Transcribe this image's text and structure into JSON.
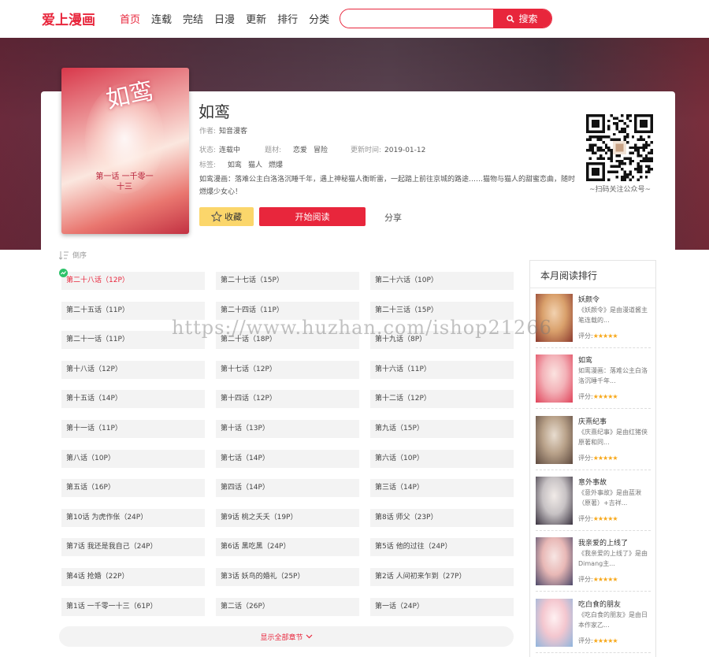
{
  "header": {
    "logo": "爱上漫画",
    "nav": [
      "首页",
      "连载",
      "完结",
      "日漫",
      "更新",
      "排行",
      "分类"
    ],
    "search_placeholder": "",
    "search_button": "搜索"
  },
  "book": {
    "title": "如鸾",
    "author_label": "作者:",
    "author": "知音漫客",
    "status_label": "状态:",
    "status": "连载中",
    "genre_label": "题材:",
    "genres": [
      "恋爱",
      "冒险"
    ],
    "updated_label": "更新时间:",
    "updated": "2019-01-12",
    "tags_label": "标签:",
    "tags": [
      "如鸾",
      "猫人",
      "燃爆"
    ],
    "description": "如鸾漫画：落难公主白洛洛沉睡千年，遇上神秘猫人衡昕雷，一起踏上前往京城的路途……猫物与猫人的甜蜜恋曲，随时燃爆少女心！",
    "fav_button": "收藏",
    "read_button": "开始阅读",
    "share": "分享",
    "qr_caption": "~扫码关注公众号~",
    "cover_art_title": "如鸾",
    "cover_art_sub": "第一话 一千零一十三"
  },
  "chapters": {
    "sort_label": "倒序",
    "items": [
      "第二十八话（12P）",
      "第二十七话（15P）",
      "第二十六话（10P）",
      "第二十五话（11P）",
      "第二十四话（11P）",
      "第二十三话（15P）",
      "第二十一话（11P）",
      "第二十话（18P）",
      "第十九话（8P）",
      "第十八话（12P）",
      "第十七话（12P）",
      "第十六话（11P）",
      "第十五话（14P）",
      "第十四话（12P）",
      "第十二话（12P）",
      "第十一话（11P）",
      "第十话（13P）",
      "第九话（15P）",
      "第八话（10P）",
      "第七话（14P）",
      "第六话（10P）",
      "第五话（16P）",
      "第四话（14P）",
      "第三话（14P）",
      "第10话 为虎作伥（24P）",
      "第9话 桃之夭夭（19P）",
      "第8话 师父（23P）",
      "第7话 我还是我自己（24P）",
      "第6话 黑吃黑（24P）",
      "第5话 他的过往（24P）",
      "第4话 抢婚（22P）",
      "第3话 妖鸟的婚礼（25P）",
      "第2话 人间初来乍到（27P）",
      "第1话 一千零一十三（61P）",
      "第二话（26P）",
      "第一话（24P）"
    ],
    "current_index": 0,
    "show_all": "显示全部章节"
  },
  "ranking": {
    "title": "本月阅读排行",
    "score_label": "评分:",
    "items": [
      {
        "name": "妖颜令",
        "desc": "《妖颜令》是由漫道酱主笔连载的...",
        "stars": "★★★★★",
        "colors": [
          "#d9a06b",
          "#8c3a2e",
          "#f2d2b0"
        ]
      },
      {
        "name": "如鸾",
        "desc": "如鸾漫画：落难公主白洛洛沉睡千年...",
        "stars": "★★★★★",
        "colors": [
          "#f3b2b8",
          "#e0435a",
          "#fbe3e0"
        ]
      },
      {
        "name": "庆熹纪事",
        "desc": "《庆熹纪事》是由红猪侠原著和同...",
        "stars": "★★★★★",
        "colors": [
          "#b9a28a",
          "#5e4a3f",
          "#e8ddd0"
        ]
      },
      {
        "name": "意外事故",
        "desc": "《意外事故》是由蓝湫（原著）+吉祥...",
        "stars": "★★★★★",
        "colors": [
          "#c7c2c4",
          "#3a3340",
          "#f1ebe8"
        ]
      },
      {
        "name": "我亲爱的上线了",
        "desc": "《我亲爱的上线了》是由Dimang主...",
        "stars": "★★★★★",
        "colors": [
          "#e8b8b6",
          "#4e4a6a",
          "#f7e6e4"
        ]
      },
      {
        "name": "吃白食的朋友",
        "desc": "《吃白食的朋友》是由日本作家乙...",
        "stars": "★★★★★",
        "colors": [
          "#f4c7cf",
          "#8fb5dd",
          "#fff1f2"
        ]
      }
    ]
  },
  "watermark": "https://www.huzhan.com/ishop21266"
}
